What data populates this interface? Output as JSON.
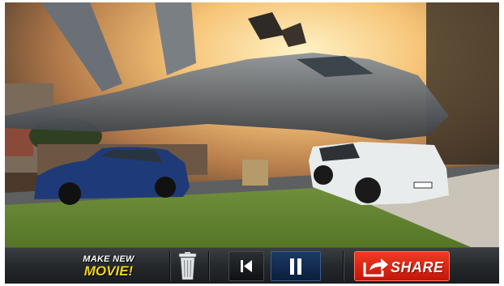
{
  "toolbar": {
    "make_new_line1": "MAKE NEW",
    "make_new_line2": "MOVIE!",
    "share_label": "SHARE"
  },
  "icons": {
    "trash": "trash-icon",
    "previous": "skip-previous-icon",
    "pause": "pause-icon",
    "share": "share-arrow-icon"
  },
  "colors": {
    "share_button": "#e2281a",
    "pause_button": "#142f57",
    "make_new_accent": "#f0d21a"
  }
}
